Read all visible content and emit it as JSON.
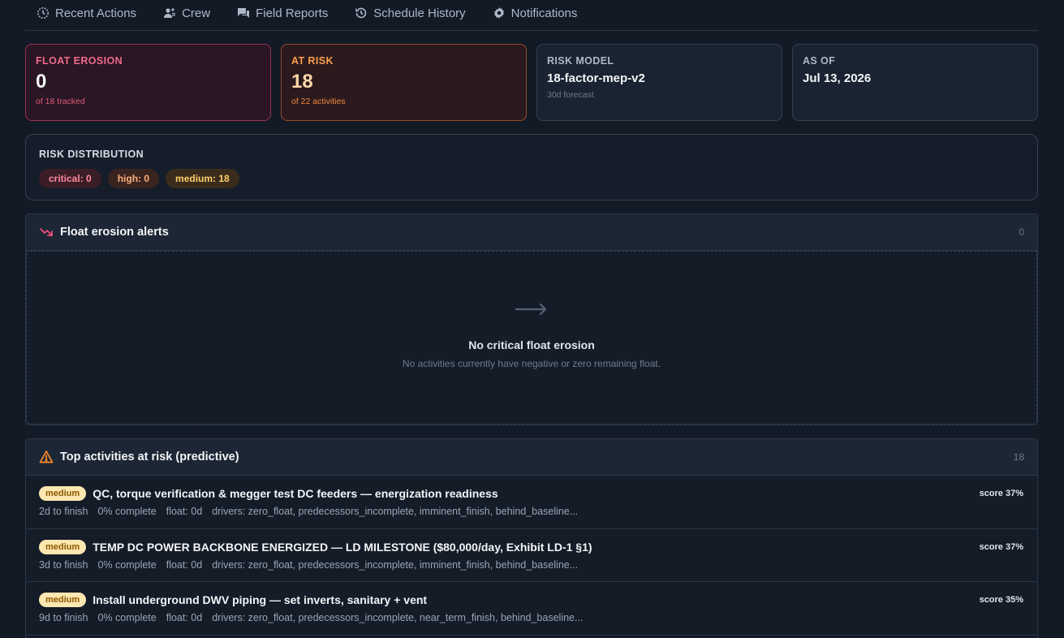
{
  "nav": [
    {
      "label": "Recent Actions",
      "icon": "clock-icon"
    },
    {
      "label": "Crew",
      "icon": "crew-icon"
    },
    {
      "label": "Field Reports",
      "icon": "chat-icon"
    },
    {
      "label": "Schedule History",
      "icon": "history-icon"
    },
    {
      "label": "Notifications",
      "icon": "gear-icon"
    }
  ],
  "cards": {
    "float_erosion": {
      "label": "FLOAT EROSION",
      "value": "0",
      "sub": "of 18 tracked"
    },
    "at_risk": {
      "label": "AT RISK",
      "value": "18",
      "sub": "of 22 activities"
    },
    "risk_model": {
      "label": "RISK MODEL",
      "value": "18-factor-mep-v2",
      "sub": "30d forecast"
    },
    "as_of": {
      "label": "AS OF",
      "value": "Jul 13, 2026"
    }
  },
  "distribution": {
    "label": "RISK DISTRIBUTION",
    "critical": "critical: 0",
    "high": "high: 0",
    "medium": "medium: 18"
  },
  "float_alerts": {
    "title": "Float erosion alerts",
    "count": "0",
    "empty_title": "No critical float erosion",
    "empty_sub": "No activities currently have negative or zero remaining float."
  },
  "top_risk": {
    "title": "Top activities at risk (predictive)",
    "count": "18",
    "rows": [
      {
        "badge": "medium",
        "title": "QC, torque verification & megger test DC feeders — energization readiness",
        "score": "score 37%",
        "finish": "2d to finish",
        "complete": "0% complete",
        "float": "float: 0d",
        "drivers": "drivers: zero_float, predecessors_incomplete, imminent_finish, behind_baseline..."
      },
      {
        "badge": "medium",
        "title": "TEMP DC POWER BACKBONE ENERGIZED — LD MILESTONE ($80,000/day, Exhibit LD-1 §1)",
        "score": "score 37%",
        "finish": "3d to finish",
        "complete": "0% complete",
        "float": "float: 0d",
        "drivers": "drivers: zero_float, predecessors_incomplete, imminent_finish, behind_baseline..."
      },
      {
        "badge": "medium",
        "title": "Install underground DWV piping — set inverts, sanitary + vent",
        "score": "score 35%",
        "finish": "9d to finish",
        "complete": "0% complete",
        "float": "float: 0d",
        "drivers": "drivers: zero_float, predecessors_incomplete, near_term_finish, behind_baseline..."
      }
    ]
  }
}
